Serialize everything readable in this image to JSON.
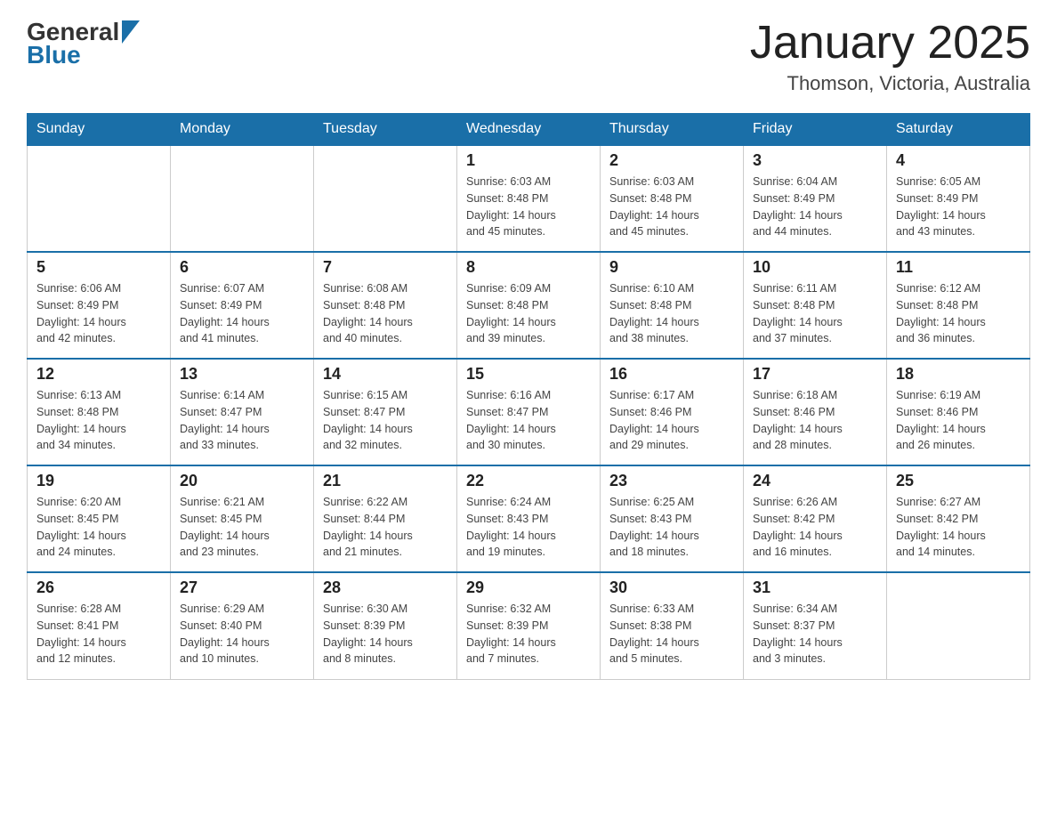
{
  "header": {
    "logo_general": "General",
    "logo_blue": "Blue",
    "month_title": "January 2025",
    "location": "Thomson, Victoria, Australia"
  },
  "days_of_week": [
    "Sunday",
    "Monday",
    "Tuesday",
    "Wednesday",
    "Thursday",
    "Friday",
    "Saturday"
  ],
  "weeks": [
    [
      {
        "day": "",
        "info": ""
      },
      {
        "day": "",
        "info": ""
      },
      {
        "day": "",
        "info": ""
      },
      {
        "day": "1",
        "info": "Sunrise: 6:03 AM\nSunset: 8:48 PM\nDaylight: 14 hours\nand 45 minutes."
      },
      {
        "day": "2",
        "info": "Sunrise: 6:03 AM\nSunset: 8:48 PM\nDaylight: 14 hours\nand 45 minutes."
      },
      {
        "day": "3",
        "info": "Sunrise: 6:04 AM\nSunset: 8:49 PM\nDaylight: 14 hours\nand 44 minutes."
      },
      {
        "day": "4",
        "info": "Sunrise: 6:05 AM\nSunset: 8:49 PM\nDaylight: 14 hours\nand 43 minutes."
      }
    ],
    [
      {
        "day": "5",
        "info": "Sunrise: 6:06 AM\nSunset: 8:49 PM\nDaylight: 14 hours\nand 42 minutes."
      },
      {
        "day": "6",
        "info": "Sunrise: 6:07 AM\nSunset: 8:49 PM\nDaylight: 14 hours\nand 41 minutes."
      },
      {
        "day": "7",
        "info": "Sunrise: 6:08 AM\nSunset: 8:48 PM\nDaylight: 14 hours\nand 40 minutes."
      },
      {
        "day": "8",
        "info": "Sunrise: 6:09 AM\nSunset: 8:48 PM\nDaylight: 14 hours\nand 39 minutes."
      },
      {
        "day": "9",
        "info": "Sunrise: 6:10 AM\nSunset: 8:48 PM\nDaylight: 14 hours\nand 38 minutes."
      },
      {
        "day": "10",
        "info": "Sunrise: 6:11 AM\nSunset: 8:48 PM\nDaylight: 14 hours\nand 37 minutes."
      },
      {
        "day": "11",
        "info": "Sunrise: 6:12 AM\nSunset: 8:48 PM\nDaylight: 14 hours\nand 36 minutes."
      }
    ],
    [
      {
        "day": "12",
        "info": "Sunrise: 6:13 AM\nSunset: 8:48 PM\nDaylight: 14 hours\nand 34 minutes."
      },
      {
        "day": "13",
        "info": "Sunrise: 6:14 AM\nSunset: 8:47 PM\nDaylight: 14 hours\nand 33 minutes."
      },
      {
        "day": "14",
        "info": "Sunrise: 6:15 AM\nSunset: 8:47 PM\nDaylight: 14 hours\nand 32 minutes."
      },
      {
        "day": "15",
        "info": "Sunrise: 6:16 AM\nSunset: 8:47 PM\nDaylight: 14 hours\nand 30 minutes."
      },
      {
        "day": "16",
        "info": "Sunrise: 6:17 AM\nSunset: 8:46 PM\nDaylight: 14 hours\nand 29 minutes."
      },
      {
        "day": "17",
        "info": "Sunrise: 6:18 AM\nSunset: 8:46 PM\nDaylight: 14 hours\nand 28 minutes."
      },
      {
        "day": "18",
        "info": "Sunrise: 6:19 AM\nSunset: 8:46 PM\nDaylight: 14 hours\nand 26 minutes."
      }
    ],
    [
      {
        "day": "19",
        "info": "Sunrise: 6:20 AM\nSunset: 8:45 PM\nDaylight: 14 hours\nand 24 minutes."
      },
      {
        "day": "20",
        "info": "Sunrise: 6:21 AM\nSunset: 8:45 PM\nDaylight: 14 hours\nand 23 minutes."
      },
      {
        "day": "21",
        "info": "Sunrise: 6:22 AM\nSunset: 8:44 PM\nDaylight: 14 hours\nand 21 minutes."
      },
      {
        "day": "22",
        "info": "Sunrise: 6:24 AM\nSunset: 8:43 PM\nDaylight: 14 hours\nand 19 minutes."
      },
      {
        "day": "23",
        "info": "Sunrise: 6:25 AM\nSunset: 8:43 PM\nDaylight: 14 hours\nand 18 minutes."
      },
      {
        "day": "24",
        "info": "Sunrise: 6:26 AM\nSunset: 8:42 PM\nDaylight: 14 hours\nand 16 minutes."
      },
      {
        "day": "25",
        "info": "Sunrise: 6:27 AM\nSunset: 8:42 PM\nDaylight: 14 hours\nand 14 minutes."
      }
    ],
    [
      {
        "day": "26",
        "info": "Sunrise: 6:28 AM\nSunset: 8:41 PM\nDaylight: 14 hours\nand 12 minutes."
      },
      {
        "day": "27",
        "info": "Sunrise: 6:29 AM\nSunset: 8:40 PM\nDaylight: 14 hours\nand 10 minutes."
      },
      {
        "day": "28",
        "info": "Sunrise: 6:30 AM\nSunset: 8:39 PM\nDaylight: 14 hours\nand 8 minutes."
      },
      {
        "day": "29",
        "info": "Sunrise: 6:32 AM\nSunset: 8:39 PM\nDaylight: 14 hours\nand 7 minutes."
      },
      {
        "day": "30",
        "info": "Sunrise: 6:33 AM\nSunset: 8:38 PM\nDaylight: 14 hours\nand 5 minutes."
      },
      {
        "day": "31",
        "info": "Sunrise: 6:34 AM\nSunset: 8:37 PM\nDaylight: 14 hours\nand 3 minutes."
      },
      {
        "day": "",
        "info": ""
      }
    ]
  ]
}
